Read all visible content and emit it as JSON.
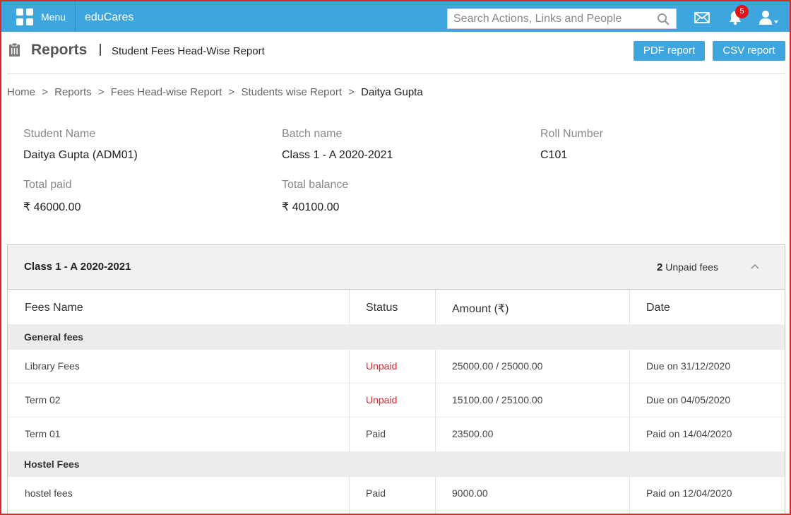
{
  "topbar": {
    "menu_label": "Menu",
    "brand": "eduCares",
    "search_placeholder": "Search Actions, Links and People",
    "notification_count": "5"
  },
  "header": {
    "title": "Reports",
    "subtitle": "Student Fees Head-Wise Report",
    "pdf_button": "PDF report",
    "csv_button": "CSV report"
  },
  "breadcrumb": {
    "items": [
      "Home",
      "Reports",
      "Fees Head-wise Report",
      "Students wise Report"
    ],
    "current": "Daitya Gupta",
    "separator": ">"
  },
  "student": {
    "name_label": "Student Name",
    "name_value": "Daitya Gupta (ADM01)",
    "batch_label": "Batch name",
    "batch_value": "Class 1 - A 2020-2021",
    "roll_label": "Roll Number",
    "roll_value": "C101",
    "paid_label": "Total paid",
    "paid_value": "₹ 46000.00",
    "balance_label": "Total balance",
    "balance_value": "₹ 40100.00"
  },
  "panel": {
    "title": "Class 1 - A 2020-2021",
    "unpaid_count": "2",
    "unpaid_label": "Unpaid fees",
    "columns": [
      "Fees Name",
      "Status",
      "Amount (₹)",
      "Date"
    ],
    "groups": [
      {
        "name": "General fees",
        "rows": [
          {
            "fee": "Library Fees",
            "status": "Unpaid",
            "amount": "25000.00 / 25000.00",
            "date": "Due on 31/12/2020"
          },
          {
            "fee": "Term 02",
            "status": "Unpaid",
            "amount": "15100.00 / 25100.00",
            "date": "Due on 04/05/2020"
          },
          {
            "fee": "Term 01",
            "status": "Paid",
            "amount": "23500.00",
            "date": "Paid on 14/04/2020"
          }
        ]
      },
      {
        "name": "Hostel Fees",
        "rows": [
          {
            "fee": "hostel fees",
            "status": "Paid",
            "amount": "9000.00",
            "date": "Paid on 12/04/2020"
          }
        ]
      }
    ]
  },
  "colors": {
    "accent": "#3fa5de",
    "unpaid": "#d9272e",
    "frame": "#d9272e"
  }
}
